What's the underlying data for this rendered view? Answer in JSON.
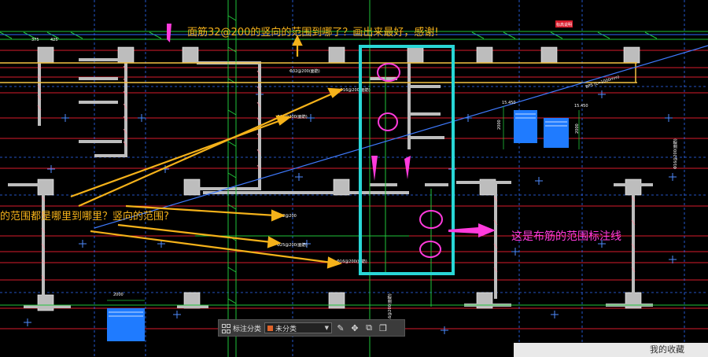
{
  "annotations": {
    "question_top": "面筋32@200的竖向的范围到哪了？画出来最好，感谢!",
    "question_left": "的范围都是哪里到哪里？竖向的范围?",
    "range_note": "这是布筋的范围标注线"
  },
  "drawing_labels": {
    "rebar_top": "Φ32@200(面筋)",
    "rebar_mid1": "Φ16@200(面筋)",
    "rebar_mid2": "Φ16@200(面筋)",
    "rebar_left1": "Φ32@200",
    "rebar_left2": "Φ25@200(面筋)",
    "rebar_left3": "Φ16@200(面筋)",
    "rebar_right_vert": "Φ16@200(面筋)",
    "rebar_bottom_vert": "Φ16@200(面筋)",
    "diag": "BPS (L=1000mm)",
    "dim_375": "375",
    "dim_425": "425",
    "dim_2000a": "2000",
    "dim_2000b": "2000",
    "dim_2000c": "2000",
    "dim_15450a": "15.450",
    "dim_15450b": "15.450",
    "red_tag": "标高说明"
  },
  "toolbar": {
    "label": "标注分类",
    "category_value": "未分类"
  },
  "favorites": "我的收藏",
  "colors": {
    "background": "#000000",
    "yellow_text": "#f5b21a",
    "magenta": "#ff3bdc",
    "cyan_box": "#29d6d6",
    "grid_red": "#d81b2b",
    "blue_lines": "#2f6dff",
    "green": "#21c43a"
  }
}
